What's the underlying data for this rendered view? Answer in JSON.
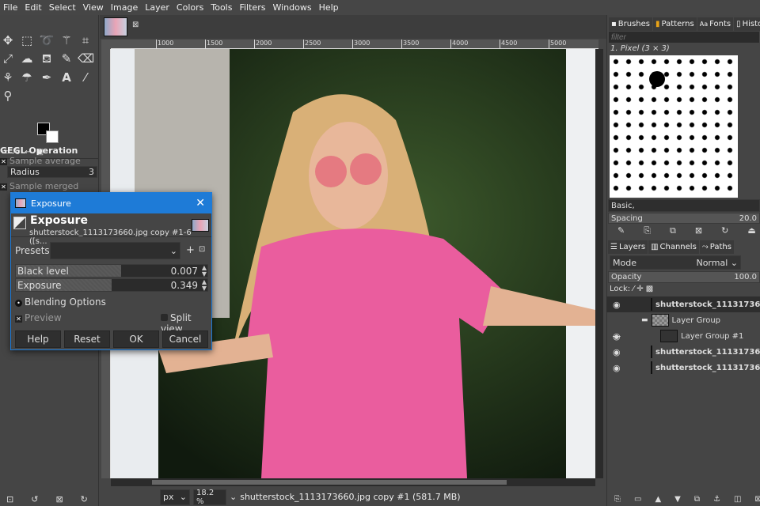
{
  "menu": [
    "File",
    "Edit",
    "Select",
    "View",
    "Image",
    "Layer",
    "Colors",
    "Tools",
    "Filters",
    "Windows",
    "Help"
  ],
  "tool_options": {
    "title": "GEGL Operation",
    "sample_average": "Sample average",
    "radius_label": "Radius",
    "radius_value": "3",
    "sample_merged": "Sample merged"
  },
  "dialog": {
    "window_title": "Exposure",
    "heading": "Exposure",
    "subtitle": "shutterstock_1113173660.jpg copy #1-6 ([s...",
    "presets_label": "Presets:",
    "black_level_label": "Black level",
    "black_level_value": "0.007",
    "black_level_fraction": 0.55,
    "exposure_label": "Exposure",
    "exposure_value": "0.349",
    "exposure_fraction": 0.5,
    "blending": "Blending Options",
    "preview": "Preview",
    "split_view": "Split view",
    "help": "Help",
    "reset": "Reset",
    "ok": "OK",
    "cancel": "Cancel"
  },
  "ruler": [
    "1000",
    "1500",
    "2000",
    "2500",
    "3000",
    "3500",
    "4000",
    "4500",
    "5000"
  ],
  "status": {
    "unit": "px",
    "zoom": "18.2 %",
    "info": "shutterstock_1113173660.jpg copy #1 (581.7 MB)"
  },
  "brushes": {
    "tabs": [
      "Brushes",
      "Patterns",
      "Fonts",
      "History"
    ],
    "filter_placeholder": "filter",
    "selected": "1. Pixel (3 × 3)",
    "preset": "Basic,",
    "spacing_label": "Spacing",
    "spacing_value": "20.0"
  },
  "layers": {
    "tabs": [
      "Layers",
      "Channels",
      "Paths"
    ],
    "mode_label": "Mode",
    "mode_value": "Normal",
    "opacity_label": "Opacity",
    "opacity_value": "100.0",
    "lock_label": "Lock:",
    "items": [
      {
        "name": "shutterstock_11131736"
      },
      {
        "name": "Layer Group"
      },
      {
        "name": "Layer Group #1"
      },
      {
        "name": "shutterstock_11131736"
      },
      {
        "name": "shutterstock_11131736"
      }
    ]
  }
}
